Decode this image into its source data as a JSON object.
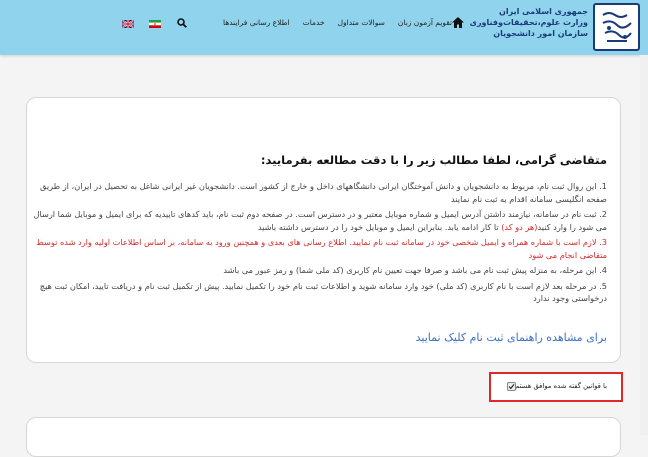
{
  "header": {
    "brand_line1": "جمهوری اسلامی ایران",
    "brand_line2": "وزارت علوم،تحقیقات‌وفناوری",
    "brand_line3": "سازمان امور دانشجویان",
    "nav": [
      {
        "label": "اطلاع رسانی فرایندها"
      },
      {
        "label": "خدمات"
      },
      {
        "label": "سوالات متداول"
      },
      {
        "label": "تقویم آزمون زبان"
      }
    ],
    "header_color": "#8fd4ec",
    "brand_color": "#1b3a7a"
  },
  "notice": {
    "title": "متقاضی گرامی، لطفا مطالب زیر را با دقت مطالعه بفرمایید:",
    "items": [
      {
        "num": "1.",
        "text": "این روال ثبت نام، مربوط به دانشجویان و دانش آموختگان ایرانی دانشگاههای داخل و خارج از کشور است. دانشجویان غیر ایرانی شاغل به تحصیل در ایران، از طریق صفحه انگلیسی سامانه اقدام به ثبت نام نمایند"
      },
      {
        "num": "2.",
        "text_before": "ثبت نام در سامانه، نیازمند داشتن آدرس ایمیل و شماره موبایل معتبر و در دسترس است. در صفحه دوم ثبت نام، باید کدهای تاییدیه که برای ایمیل و موبایل شما ارسال می شود را وارد کنید",
        "text_red": "(هر دو کد)",
        "text_after": " تا کار ادامه یابد. بنابراین ایمیل و موبایل خود را در دسترس داشته باشید"
      },
      {
        "num": "3.",
        "text": "لازم است با شماره همراه و ایمیل شخصی خود در سامانه ثبت نام نمایید. اطلاع رسانی های بعدی و همچنین ورود به سامانه، بر اساس اطلاعات اولیه وارد شده توسط متقاضی انجام می شود"
      },
      {
        "num": "4.",
        "text": "این مرحله، به منزله پیش ثبت نام می باشد و صرفا جهت تعیین نام کاربری (کد ملی شما) و رمز عبور می باشد"
      },
      {
        "num": "5.",
        "text": "در مرحله بعد لازم است با نام کاربری (کد ملی) خود وارد سامانه شوید و اطلاعات ثبت نام خود را تکمیل نمایید. پیش از تکمیل ثبت نام و دریافت تایید، امکان ثبت هیچ درخواستی وجود ندارد"
      }
    ],
    "guide_link": "برای مشاهده راهنمای ثبت نام کلیک نمایید",
    "red_color": "#d42a2a",
    "link_color": "#3a6fc2"
  },
  "agreement": {
    "label": "با قوانین گفته شده موافق هستم",
    "checked": "true",
    "highlight_color": "#e0272b"
  },
  "icons": {
    "home": "home-icon",
    "search": "search-icon",
    "flag_ir": "iran-flag-icon",
    "flag_uk": "uk-flag-icon"
  }
}
